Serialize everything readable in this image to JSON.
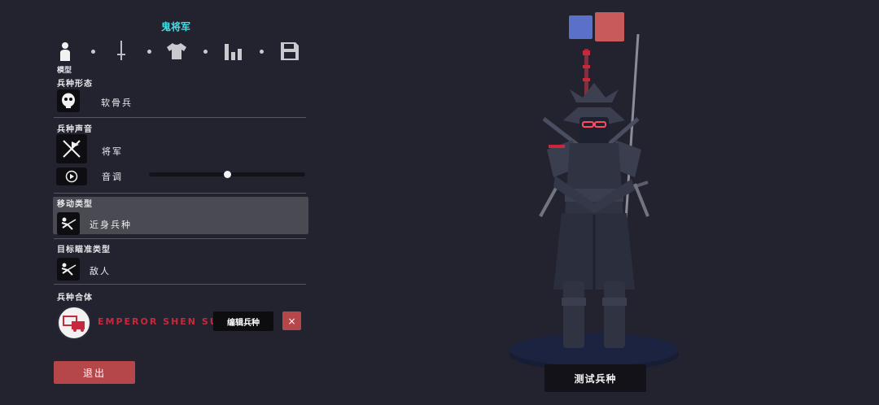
{
  "header": {
    "unit_title": "鬼将军"
  },
  "steps": {
    "model_label": "模型",
    "icons": [
      "person-icon",
      "sword-icon",
      "shirt-icon",
      "stats-icon",
      "save-icon"
    ]
  },
  "sections": {
    "unit_form": {
      "label": "兵种形态",
      "value": "软骨兵"
    },
    "unit_voice": {
      "label": "兵种声音",
      "value": "将军",
      "pitch_label": "音调",
      "pitch_level": 0.5
    },
    "move_type": {
      "label": "移动类型",
      "value": "近身兵种"
    },
    "target_type": {
      "label": "目标瞄准类型",
      "value": "敌人"
    },
    "merge": {
      "label": "兵种合体",
      "unit_name": "EMPEROR SHEN SUN",
      "edit_label": "编辑兵种",
      "close_label": "×"
    }
  },
  "buttons": {
    "exit": "退出",
    "test_unit": "测试兵种"
  },
  "teams": {
    "blue": "#5a70c9",
    "red": "#c85a5c"
  },
  "colors": {
    "accent_cyan": "#3ee0e6",
    "accent_red": "#b5464a",
    "merge_name": "#c8283c"
  }
}
